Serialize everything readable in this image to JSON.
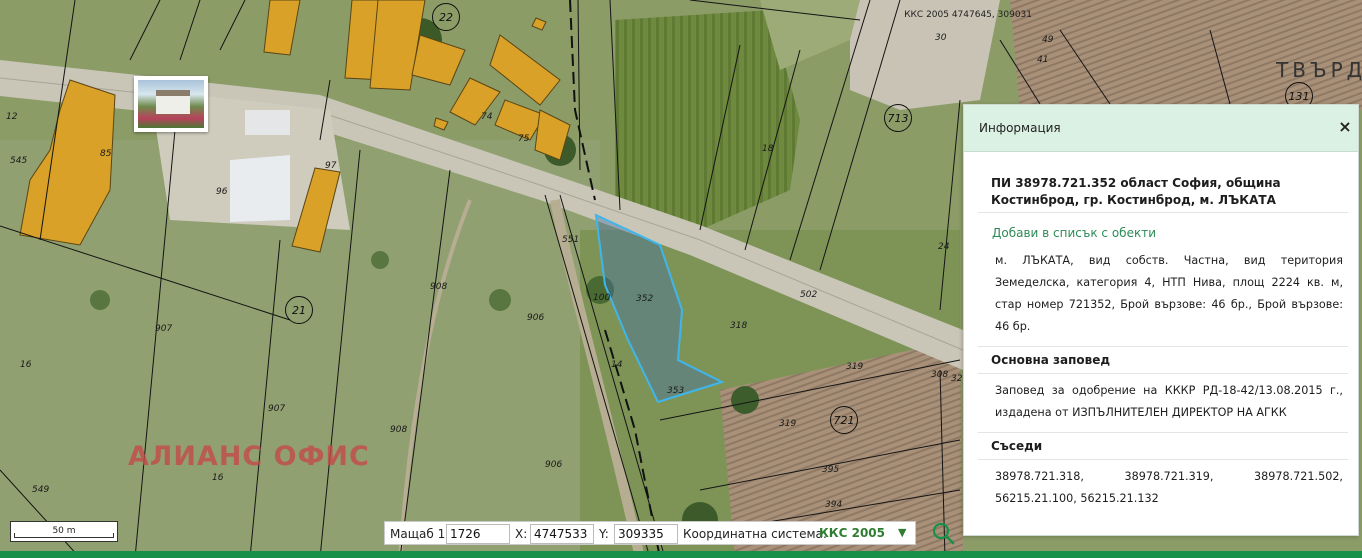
{
  "map": {
    "coords_top": "ККС 2005 4747645, 309031",
    "region_label": "ТВЪРД",
    "watermark": "АЛИАНС ОФИС",
    "parcel_labels": [
      "352",
      "353",
      "318",
      "319",
      "319",
      "395",
      "394",
      "502",
      "551",
      "100",
      "14",
      "906",
      "906",
      "907",
      "907",
      "908",
      "908",
      "16",
      "16",
      "549",
      "96",
      "97",
      "85",
      "74",
      "75",
      "545",
      "12",
      "18",
      "24",
      "30",
      "41",
      "49",
      "308",
      "32",
      "22"
    ],
    "circle_labels": [
      "21",
      "713",
      "721",
      "131",
      "22"
    ],
    "photo_icon": "photo-thumbnail"
  },
  "info_panel": {
    "title": "Информация",
    "close_icon": "×",
    "parcel_title": "ПИ 38978.721.352 област София, община Костинброд, гр. Костинброд, м. ЛЪКАТА",
    "add_to_list": "Добави в списък с обекти",
    "description": "м. ЛЪКАТА, вид собств. Частна, вид територия Земеделска, категория 4, НТП Нива, площ 2224 кв. м, стар номер 721352, Брой вързове: 46 бр., Брой вързове: 46 бр.",
    "order_heading": "Основна заповед",
    "order_text": "Заповед за одобрение на КККР РД-18-42/13.08.2015 г., издадена от ИЗПЪЛНИТЕЛЕН ДИРЕКТОР НА АГКК",
    "neighbors_heading": "Съседи",
    "neighbors_text": "38978.721.318, 38978.721.319, 38978.721.502, 56215.21.100, 56215.21.132"
  },
  "bottom": {
    "scale_label": "50 m",
    "scale_prefix": "Мащаб 1:",
    "scale_value": "1726",
    "x_label": "X:",
    "x_value": "4747533",
    "y_label": "Y:",
    "y_value": "309335",
    "crs_label": "Координатна система:",
    "crs_value": "ККС 2005",
    "crs_dropdown_icon": "▼",
    "search_icon": "search-icon"
  },
  "colors": {
    "building": "#d9a127",
    "parcel_highlight": "#3fb6ea",
    "panel_header": "#daf1e3",
    "link": "#2e8b57",
    "bottom_stripe": "#17904a"
  }
}
